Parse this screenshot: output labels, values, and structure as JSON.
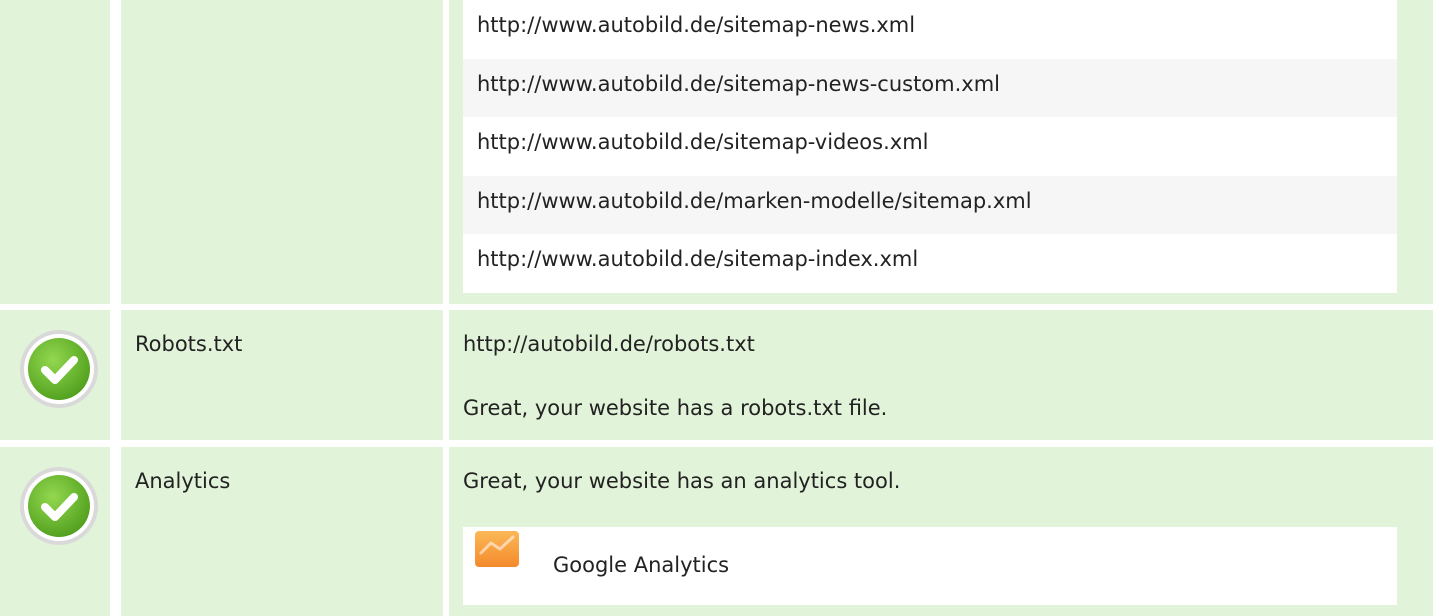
{
  "sitemaps": {
    "urls": [
      "http://www.autobild.de/sitemap-news.xml",
      "http://www.autobild.de/sitemap-news-custom.xml",
      "http://www.autobild.de/sitemap-videos.xml",
      "http://www.autobild.de/marken-modelle/sitemap.xml",
      "http://www.autobild.de/sitemap-index.xml"
    ]
  },
  "robots": {
    "label": "Robots.txt",
    "url": "http://autobild.de/robots.txt",
    "message": "Great, your website has a robots.txt file."
  },
  "analytics": {
    "label": "Analytics",
    "message": "Great, your website has an analytics tool.",
    "tool_name": "Google Analytics"
  },
  "colors": {
    "row_bg": "#e1f3d9",
    "check_green": "#6cbf30",
    "ga_orange": "#f9a13a"
  },
  "icons": {
    "status": "check-circle-icon",
    "tool": "google-analytics-icon"
  }
}
